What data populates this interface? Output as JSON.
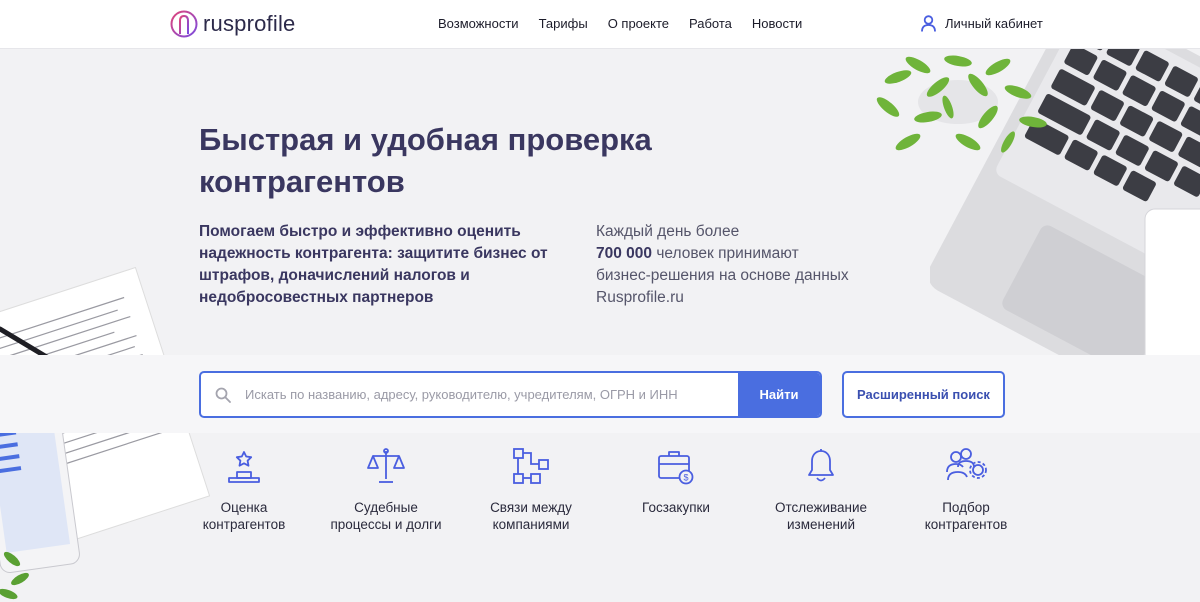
{
  "header": {
    "logo_text": "rusprofile",
    "nav": [
      {
        "label": "Возможности"
      },
      {
        "label": "Тарифы"
      },
      {
        "label": "О проекте"
      },
      {
        "label": "Работа"
      },
      {
        "label": "Новости"
      }
    ],
    "cabinet_label": "Личный кабинет"
  },
  "hero": {
    "title": "Быстрая и удобная проверка контрагентов",
    "left_text": "Помогаем быстро и эффективно оценить надежность контрагента: защитите бизнес от штрафов, доначислений налогов и недобросовестных партнеров",
    "right_prefix": "Каждый день более",
    "right_number": "700 000",
    "right_suffix": "человек принимают бизнес-решения на основе данных Rusprofile.ru"
  },
  "search": {
    "placeholder": "Искать по названию, адресу, руководителю, учредителям, ОГРН и ИНН",
    "value": "",
    "button_label": "Найти",
    "advanced_label": "Расширенный поиск"
  },
  "features": [
    {
      "label": "Оценка\nконтрагентов",
      "icon": "podium-star-icon"
    },
    {
      "label": "Судебные\nпроцессы и долги",
      "icon": "scales-icon"
    },
    {
      "label": "Связи между\nкомпаниями",
      "icon": "network-icon"
    },
    {
      "label": "Госзакупки",
      "icon": "briefcase-dollar-icon"
    },
    {
      "label": "Отслеживание\nизменений",
      "icon": "bell-icon"
    },
    {
      "label": "Подбор\nконтрагентов",
      "icon": "users-gear-icon"
    }
  ],
  "colors": {
    "accent": "#4a6ee0",
    "title": "#3a3760",
    "background": "#f2f2f4"
  }
}
